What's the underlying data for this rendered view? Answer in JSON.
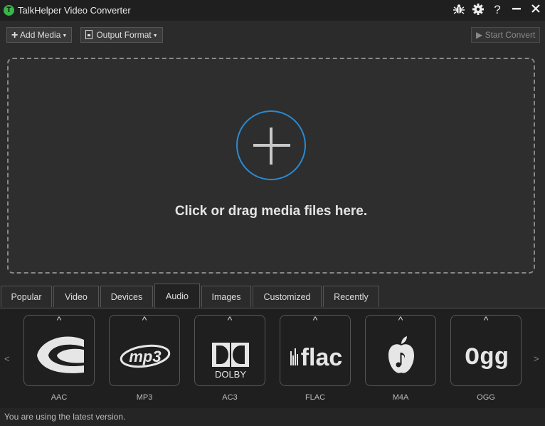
{
  "app": {
    "logo_letter": "T",
    "title": "TalkHelper Video Converter"
  },
  "window_controls": [
    "bug-icon",
    "gear-icon",
    "help-icon",
    "minimize-icon",
    "close-icon"
  ],
  "toolbar": {
    "add_media": "Add Media",
    "output_format": "Output Format",
    "start_convert": "Start Convert"
  },
  "dropzone": {
    "text": "Click or drag media files here."
  },
  "tabs": [
    "Popular",
    "Video",
    "Devices",
    "Audio",
    "Images",
    "Customized",
    "Recently"
  ],
  "active_tab": "Audio",
  "formats": {
    "prev": "<",
    "next": ">",
    "items": [
      {
        "label": "AAC",
        "logo_text": ""
      },
      {
        "label": "MP3",
        "logo_text": "mp3"
      },
      {
        "label": "AC3",
        "logo_text": "DOLBY"
      },
      {
        "label": "FLAC",
        "logo_text": "flac"
      },
      {
        "label": "M4A",
        "logo_text": ""
      },
      {
        "label": "OGG",
        "logo_text": "Ogg"
      }
    ]
  },
  "status": {
    "text": "You are using the latest version."
  },
  "colors": {
    "accent": "#2a8bd2",
    "logo": "#3bb54a",
    "background": "#2b2b2b"
  }
}
